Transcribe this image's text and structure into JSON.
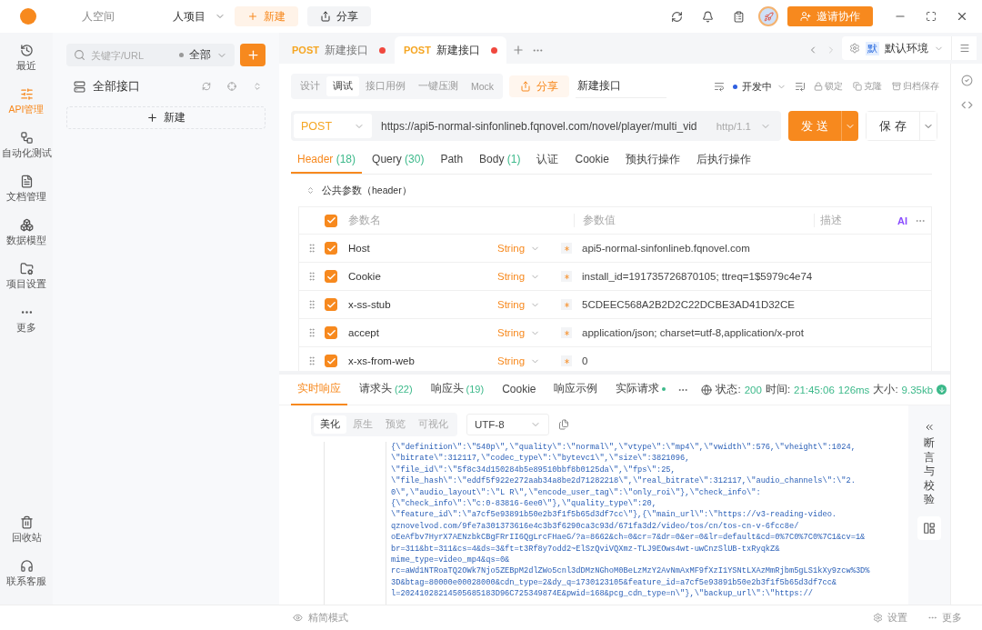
{
  "top_bar": {
    "workspace": "人空间",
    "project": "人项目",
    "new_button": "新建",
    "share_button": "分享",
    "invite_button": "邀请协作"
  },
  "nav": [
    {
      "label": "最近",
      "selected": false
    },
    {
      "label": "API管理",
      "selected": true
    },
    {
      "label": "自动化测试",
      "selected": false
    },
    {
      "label": "文档管理",
      "selected": false
    },
    {
      "label": "数据模型",
      "selected": false
    },
    {
      "label": "项目设置",
      "selected": false
    },
    {
      "label": "更多",
      "selected": false
    }
  ],
  "nav_bottom": [
    {
      "label": "回收站",
      "selected": false
    },
    {
      "label": "联系客服",
      "selected": false
    }
  ],
  "tree": {
    "search_placeholder": "关键字/URL",
    "filter": "全部",
    "root": "全部接口",
    "new_button": "新建"
  },
  "tabs": [
    {
      "method": "POST",
      "title": "新建接口",
      "selected": false,
      "unsaved": true
    },
    {
      "method": "POST",
      "title": "新建接口",
      "selected": true,
      "unsaved": true
    }
  ],
  "environment": {
    "badge": "默",
    "name": "默认环境"
  },
  "mode_tabs": [
    {
      "label": "设计",
      "selected": false
    },
    {
      "label": "调试",
      "selected": true
    },
    {
      "label": "接口用例",
      "selected": false
    },
    {
      "label": "一键压测",
      "selected": false
    },
    {
      "label": "Mock",
      "selected": false
    }
  ],
  "share_button": "分享",
  "api_name": "新建接口",
  "api_status": "开发中",
  "actions": [
    "锁定",
    "克隆",
    "归档保存"
  ],
  "request": {
    "method": "POST",
    "url": "https://api5-normal-sinfonlineb.fqnovel.com/novel/player/multi_vid",
    "protocol": "http/1.1",
    "send": "发 送",
    "save": "保 存"
  },
  "param_tabs": [
    {
      "label": "Header",
      "count": "(18)",
      "selected": true
    },
    {
      "label": "Query",
      "count": "(30)",
      "selected": false
    },
    {
      "label": "Path",
      "selected": false
    },
    {
      "label": "Body",
      "count": "(1)",
      "selected": false
    },
    {
      "label": "认证",
      "selected": false
    },
    {
      "label": "Cookie",
      "selected": false
    },
    {
      "label": "预执行操作",
      "selected": false
    },
    {
      "label": "后执行操作",
      "selected": false
    }
  ],
  "public_params": "公共参数（header）",
  "headers": {
    "all_checked": true,
    "columns": [
      "参数名",
      "参数值",
      "描述"
    ],
    "ai_label": "AI",
    "rows": [
      {
        "checked": true,
        "name": "Host",
        "type": "String",
        "required": true,
        "value": "api5-normal-sinfonlineb.fqnovel.com"
      },
      {
        "checked": true,
        "name": "Cookie",
        "type": "String",
        "required": true,
        "value": "install_id=191735726870105; ttreq=1$5979c4e74"
      },
      {
        "checked": true,
        "name": "x-ss-stub",
        "type": "String",
        "required": true,
        "value": "5CDEEC568A2B2D2C22DCBE3AD41D32CE"
      },
      {
        "checked": true,
        "name": "accept",
        "type": "String",
        "required": true,
        "value": "application/json; charset=utf-8,application/x-prot"
      },
      {
        "checked": true,
        "name": "x-xs-from-web",
        "type": "String",
        "required": true,
        "value": "0"
      }
    ]
  },
  "response_tabs": [
    {
      "label": "实时响应",
      "selected": true
    },
    {
      "label": "请求头",
      "count": "(22)",
      "selected": false
    },
    {
      "label": "响应头",
      "count": "(19)",
      "selected": false
    },
    {
      "label": "Cookie",
      "selected": false
    },
    {
      "label": "响应示例",
      "selected": false
    },
    {
      "label": "实际请求",
      "selected": false,
      "dot": true
    }
  ],
  "response_status": {
    "status_label": "状态:",
    "status": "200",
    "time_label": "时间:",
    "time": "21:45:06",
    "duration": "126ms",
    "size_label": "大小:",
    "size": "9.35kb"
  },
  "view_tabs": [
    {
      "label": "美化",
      "selected": true
    },
    {
      "label": "原生",
      "selected": false
    },
    {
      "label": "预览",
      "selected": false
    },
    {
      "label": "可视化",
      "selected": false
    }
  ],
  "encoding": "UTF-8",
  "code_lines": [
    "{\\\"definition\\\":\\\"540p\\\",\\\"quality\\\":\\\"normal\\\",\\\"vtype\\\":\\\"mp4\\\",\\\"vwidth\\\":576,\\\"vheight\\\":1024,",
    "\\\"bitrate\\\":312117,\\\"codec_type\\\":\\\"bytevc1\\\",\\\"size\\\":3821096,",
    "\\\"file_id\\\":\\\"5f8c34d150284b5e89510bbf8b0125da\\\",\\\"fps\\\":25,",
    "\\\"file_hash\\\":\\\"eddf5f922e272aab34a8be2d71282218\\\",\\\"real_bitrate\\\":312117,\\\"audio_channels\\\":\\\"2.",
    "0\\\",\\\"audio_layout\\\":\\\"L R\\\",\\\"encode_user_tag\\\":\\\"only_roi\\\"},\\\"check_info\\\":",
    "{\\\"check_info\\\":\\\"c:0-83816-6ee0\\\"},\\\"quality_type\\\":20,",
    "\\\"feature_id\\\":\\\"a7cf5e93891b50e2b3f1f5b65d3df7cc\\\"},{\\\"main_url\\\":\\\"https://v3-reading-video.",
    "qznovelvod.com/9fe7a301373616e4c3b3f6290ca3c93d/671fa3d2/video/tos/cn/tos-cn-v-6fcc8e/",
    "oEeAfbv7HyrX7AENzbkCBgFRrII6QgLrcFHaeG/?a=8662&ch=0&cr=7&dr=0&er=0&lr=default&cd=0%7C0%7C0%7C1&cv=1&",
    "br=311&bt=311&cs=4&ds=3&ft=t3Rf8y7odd2~ElSzQviVQXmz-TLJ9EOws4wt-uwCnzSlUB-txRyqkZ&",
    "mime_type=video_mp4&qs=0&",
    "rc=aWd1NTRoaTQ2OWk7Njo5ZEBpM2dlZWo5cnl3dDMzNGhoM0BeLzMzY2AvNmAxMF9fXzI1YSNtLXAzMmRjbm5gLS1kXy9zcw%3D%",
    "3D&btag=80000e00028000&cdn_type=2&dy_q=1730123105&feature_id=a7cf5e93891b50e2b3f1f5b65d3df7cc&",
    "l=20241028214505685183D96C725349874E&pwid=168&pcg_cdn_type=n\\\"},\\\"backup_url\\\":\\\"https://"
  ],
  "assert_panel": "断言与校验",
  "status_bar": {
    "mode": "精简模式",
    "settings": "设置",
    "more": "更多"
  }
}
